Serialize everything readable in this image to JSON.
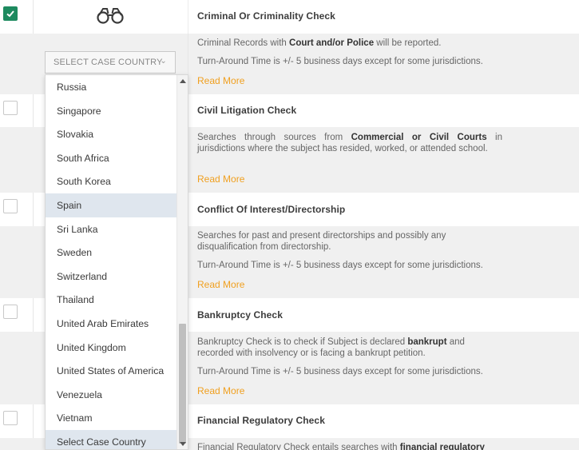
{
  "country_select": {
    "placeholder": "SELECT CASE COUNTRY",
    "options": [
      "Russia",
      "Singapore",
      "Slovakia",
      "South Africa",
      "South Korea",
      "Spain",
      "Sri Lanka",
      "Sweden",
      "Switzerland",
      "Thailand",
      "United Arab Emirates",
      "United Kingdom",
      "United States of America",
      "Venezuela",
      "Vietnam",
      "Select Case Country"
    ],
    "highlighted": [
      "Spain",
      "Select Case Country"
    ]
  },
  "checks": [
    {
      "title": "Criminal Or Criminality Check",
      "checked": true,
      "icon": "binoculars-icon",
      "desc_parts": [
        "Criminal Records with ",
        "Court and/or Police",
        " will be reported."
      ],
      "turnaround": "Turn-Around Time is +/- 5 business days except for some jurisdictions.",
      "read_more": "Read More"
    },
    {
      "title": "Civil Litigation Check",
      "checked": false,
      "desc_parts": [
        "Searches through sources from ",
        "Commercial or Civil Courts",
        " in jurisdictions where the subject has resided, worked, or attended school."
      ],
      "read_more": "Read More"
    },
    {
      "title": "Conflict Of Interest/Directorship",
      "checked": false,
      "desc": "Searches for past and present directorships and possibly any disqualification from directorship.",
      "turnaround": "Turn-Around Time is +/- 5 business days except for some jurisdictions.",
      "read_more": "Read More"
    },
    {
      "title": "Bankruptcy Check",
      "checked": false,
      "desc_parts": [
        "Bankruptcy Check is to check if Subject is declared ",
        "bankrupt",
        " and recorded with insolvency or is facing a bankrupt petition."
      ],
      "turnaround": "Turn-Around Time is +/- 5 business days except for some jurisdictions.",
      "read_more": "Read More"
    },
    {
      "title": "Financial Regulatory Check",
      "checked": false,
      "desc_parts": [
        "Financial Regulatory Check entails searches with ",
        "financial regulatory"
      ]
    }
  ],
  "colors": {
    "accent": "#f0a020",
    "check_green": "#1d8a5f",
    "row_grey": "#f0f0f0",
    "dropdown_highlight": "#dfe6ee"
  }
}
